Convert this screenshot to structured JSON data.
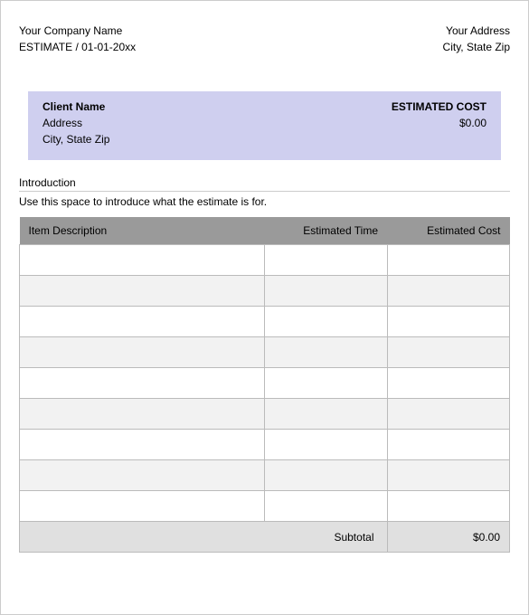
{
  "header": {
    "company_name": "Your Company Name",
    "estimate_line": "ESTIMATE / 01-01-20xx",
    "address_line1": "Your Address",
    "address_line2": "City, State Zip"
  },
  "client": {
    "name": "Client Name",
    "address": "Address",
    "city_state_zip": "City, State Zip",
    "estimated_cost_label": "ESTIMATED COST",
    "estimated_cost_value": "$0.00"
  },
  "intro": {
    "heading": "Introduction",
    "text": "Use this space to introduce what the estimate is for."
  },
  "table": {
    "col_desc": "Item Description",
    "col_time": "Estimated Time",
    "col_cost": "Estimated Cost",
    "rows": [
      {
        "desc": "",
        "time": "",
        "cost": ""
      },
      {
        "desc": "",
        "time": "",
        "cost": ""
      },
      {
        "desc": "",
        "time": "",
        "cost": ""
      },
      {
        "desc": "",
        "time": "",
        "cost": ""
      },
      {
        "desc": "",
        "time": "",
        "cost": ""
      },
      {
        "desc": "",
        "time": "",
        "cost": ""
      },
      {
        "desc": "",
        "time": "",
        "cost": ""
      },
      {
        "desc": "",
        "time": "",
        "cost": ""
      },
      {
        "desc": "",
        "time": "",
        "cost": ""
      }
    ],
    "subtotal_label": "Subtotal",
    "subtotal_value": "$0.00"
  }
}
